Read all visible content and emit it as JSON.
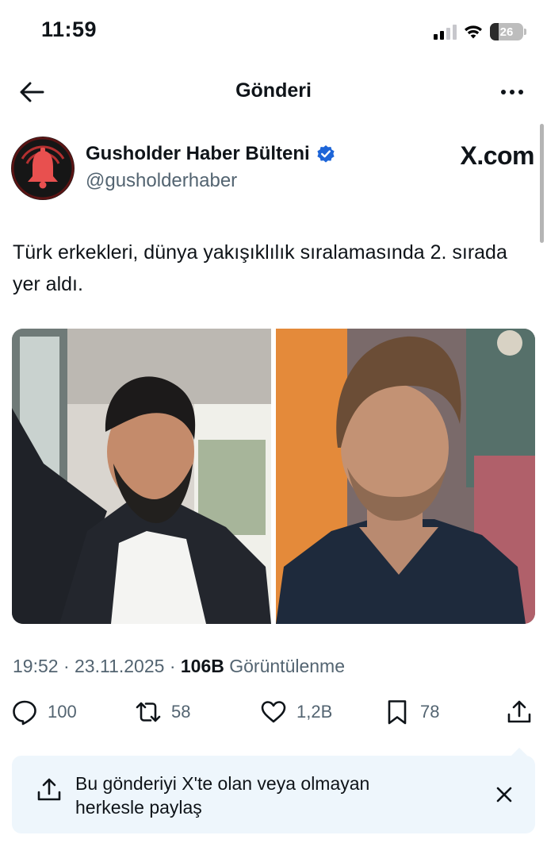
{
  "status_bar": {
    "time": "11:59",
    "battery_level": "26",
    "battery_fraction": 0.26,
    "icons": [
      "signal-icon",
      "wifi-icon",
      "battery-icon"
    ]
  },
  "header": {
    "title": "Gönderi",
    "back_icon": "arrow-left-icon",
    "more_icon": "more-horizontal-icon"
  },
  "post": {
    "author": {
      "name": "Gusholder Haber Bülteni",
      "handle": "@gusholderhaber",
      "verified": true,
      "avatar_icon": "bell-icon"
    },
    "site": "X.com",
    "text": "Türk erkekleri, dünya yakışıklılık sıralamasında 2. sırada yer aldı.",
    "images": [
      {
        "name": "photo-left",
        "description_icon": "portrait-photo"
      },
      {
        "name": "photo-right",
        "description_icon": "portrait-photo"
      }
    ],
    "time": "19:52",
    "separator": "·",
    "date": "23.11.2025",
    "views_count": "106B",
    "views_label": "Görüntülenme",
    "actions": {
      "replies": "100",
      "reposts": "58",
      "likes": "1,2B",
      "bookmarks": "78"
    }
  },
  "share_banner": {
    "text": "Bu gönderiyi X'te olan veya olmayan herkesle paylaş",
    "icon": "share-icon",
    "close_icon": "close-icon"
  },
  "colors": {
    "text": "#0f1419",
    "secondary": "#536471",
    "verified": "#1d9bf0",
    "banner_bg": "#eef6fc",
    "avatar_bell": "#e8504f"
  }
}
